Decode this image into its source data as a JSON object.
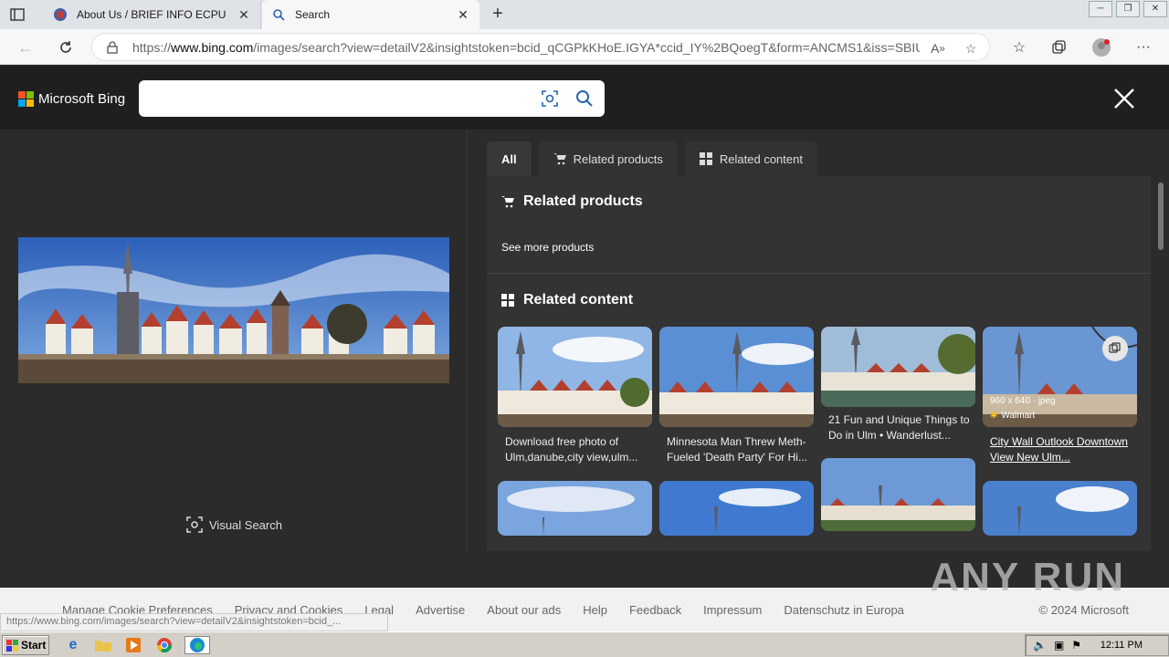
{
  "browser": {
    "tabs": [
      {
        "title": "About Us / BRIEF INFO ECPU",
        "close": "✕"
      },
      {
        "title": "Search",
        "close": "✕"
      }
    ],
    "new_tab": "+",
    "url_prefix": "https://",
    "url_domain": "www.bing.com",
    "url_rest": "/images/search?view=detailV2&insightstoken=bcid_qCGPkKHoE.IGYA*ccid_IY%2BQoegT&form=ANCMS1&iss=SBIU...",
    "window_controls": [
      "─",
      "❐",
      "✕"
    ]
  },
  "header": {
    "logo_text": "Microsoft Bing",
    "search_value": "",
    "logo_colors": [
      "#f35325",
      "#81bc06",
      "#05a6f0",
      "#ffba08"
    ]
  },
  "left": {
    "visual_search_label": "Visual Search"
  },
  "right": {
    "tabs": [
      {
        "label": "All"
      },
      {
        "label": "Related products",
        "icon": "cart-icon"
      },
      {
        "label": "Related content",
        "icon": "grid-icon"
      }
    ],
    "related_products_title": "Related products",
    "see_more": "See more products",
    "related_content_title": "Related content",
    "items": [
      {
        "caption": "Download free photo of Ulm,danube,city view,ulm..."
      },
      {
        "caption": "Minnesota Man Threw Meth-Fueled 'Death Party' For Hi..."
      },
      {
        "caption": "21 Fun and Unique Things to Do in Ulm • Wanderlust..."
      },
      {
        "caption": "City Wall Outlook Downtown View New Ulm...",
        "meta": "960 x 640 · jpeg",
        "source": "Walmart"
      }
    ]
  },
  "footer": {
    "links": [
      "Manage Cookie Preferences",
      "Privacy and Cookies",
      "Legal",
      "Advertise",
      "About our ads",
      "Help",
      "Feedback",
      "Impressum",
      "Datenschutz in Europa"
    ],
    "copyright": "© 2024 Microsoft",
    "status_url": "https://www.bing.com/images/search?view=detailV2&insightstoken=bcid_...",
    "watermark": "ANY RUN"
  },
  "taskbar": {
    "start_label": "Start",
    "clock": "12:11 PM"
  }
}
